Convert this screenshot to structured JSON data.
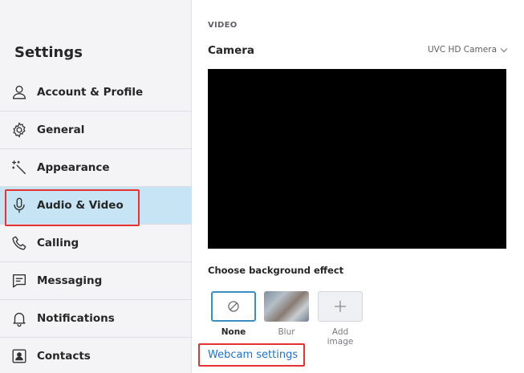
{
  "sidebar": {
    "title": "Settings",
    "items": [
      {
        "label": "Account & Profile",
        "icon": "person-icon",
        "active": false
      },
      {
        "label": "General",
        "icon": "gear-icon",
        "active": false
      },
      {
        "label": "Appearance",
        "icon": "magic-wand-icon",
        "active": false
      },
      {
        "label": "Audio & Video",
        "icon": "microphone-icon",
        "active": true
      },
      {
        "label": "Calling",
        "icon": "phone-icon",
        "active": false
      },
      {
        "label": "Messaging",
        "icon": "message-icon",
        "active": false
      },
      {
        "label": "Notifications",
        "icon": "bell-icon",
        "active": false
      },
      {
        "label": "Contacts",
        "icon": "contact-card-icon",
        "active": false
      }
    ]
  },
  "main": {
    "section_heading": "VIDEO",
    "camera_label": "Camera",
    "camera_selected": "UVC HD Camera",
    "background_effect_label": "Choose background effect",
    "effects": {
      "none": "None",
      "blur": "Blur",
      "add_image": "Add image"
    },
    "webcam_settings_link": "Webcam settings"
  },
  "colors": {
    "sidebar_bg": "#f4f4f6",
    "active_item_bg": "#c6e4f3",
    "highlight_border": "#e63232",
    "link": "#1e72c8",
    "selected_effect_border": "#3b8ec4"
  }
}
